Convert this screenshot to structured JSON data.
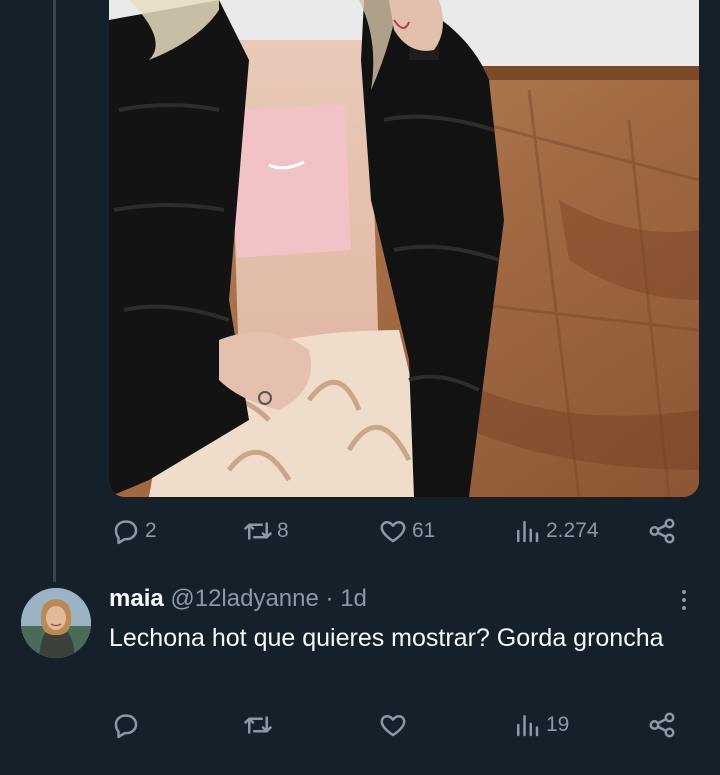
{
  "tweet": {
    "actions": {
      "replies": "2",
      "retweets": "8",
      "likes": "61",
      "views": "2.274"
    }
  },
  "reply": {
    "name": "maia",
    "handle": "@12ladyanne",
    "separator": "·",
    "time": "1d",
    "text": "Lechona hot que quieres mostrar? Gorda groncha",
    "actions": {
      "replies": "",
      "retweets": "",
      "likes": "",
      "views": "19"
    }
  },
  "colors": {
    "background": "#15202b",
    "muted": "#8b98a5",
    "text": "#f7f9f9",
    "thread_line": "#38444d"
  },
  "icons": [
    "reply-icon",
    "retweet-icon",
    "like-icon",
    "views-icon",
    "share-icon",
    "more-icon"
  ]
}
